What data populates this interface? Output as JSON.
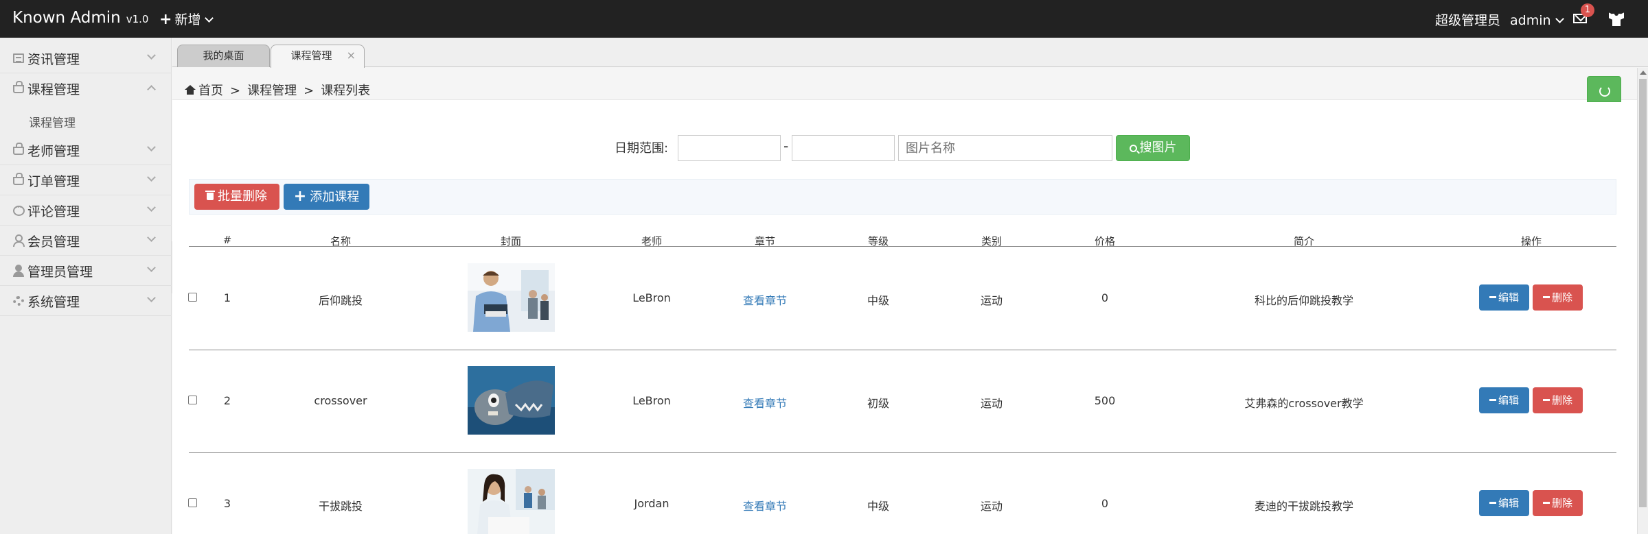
{
  "header": {
    "brand": "Known Admin",
    "version": "v1.0",
    "new_label": "新增",
    "role": "超级管理员",
    "username": "admin",
    "mail_count": "1",
    "colors": {
      "bar": "#222222"
    }
  },
  "sidebar": {
    "items": [
      {
        "label": "资讯管理",
        "icon": "document-icon"
      },
      {
        "label": "课程管理",
        "icon": "bag-icon",
        "expanded": true
      },
      {
        "label": "老师管理",
        "icon": "bag-icon"
      },
      {
        "label": "订单管理",
        "icon": "bag-icon"
      },
      {
        "label": "评论管理",
        "icon": "chat-icon"
      },
      {
        "label": "会员管理",
        "icon": "user-icon"
      },
      {
        "label": "管理员管理",
        "icon": "user-solid-icon"
      },
      {
        "label": "系统管理",
        "icon": "gear-icon"
      }
    ],
    "sub_item": "课程管理"
  },
  "tabs": [
    {
      "label": "我的桌面",
      "active": false
    },
    {
      "label": "课程管理",
      "active": true,
      "close": "×"
    }
  ],
  "breadcrumb": {
    "home": "首页",
    "sep": ">",
    "level1": "课程管理",
    "level2": "课程列表"
  },
  "search": {
    "label": "日期范围:",
    "date_from": "",
    "date_to": "",
    "dash": "-",
    "name_placeholder": "图片名称",
    "button": "搜图片"
  },
  "toolbar": {
    "batch_delete": "批量删除",
    "add_course": "添加课程"
  },
  "table": {
    "headers": {
      "index": "#",
      "name": "名称",
      "cover": "封面",
      "teacher": "老师",
      "chapter": "章节",
      "level": "等级",
      "category": "类别",
      "price": "价格",
      "intro": "简介",
      "actions": "操作"
    },
    "rows": [
      {
        "index": "1",
        "name": "后仰跳投",
        "teacher": "LeBron",
        "chapter": "查看章节",
        "level": "中级",
        "category": "运动",
        "price": "0",
        "intro": "科比的后仰跳投教学",
        "edit": "编辑",
        "delete": "删除"
      },
      {
        "index": "2",
        "name": "crossover",
        "teacher": "LeBron",
        "chapter": "查看章节",
        "level": "初级",
        "category": "运动",
        "price": "500",
        "intro": "艾弗森的crossover教学",
        "edit": "编辑",
        "delete": "删除"
      },
      {
        "index": "3",
        "name": "干拔跳投",
        "teacher": "Jordan",
        "chapter": "查看章节",
        "level": "中级",
        "category": "运动",
        "price": "0",
        "intro": "麦迪的干拔跳投教学",
        "edit": "编辑",
        "delete": "删除"
      }
    ]
  },
  "colors": {
    "success": "#5cb85c",
    "danger": "#d9534f",
    "primary": "#337ab7",
    "link": "#337ab7"
  }
}
